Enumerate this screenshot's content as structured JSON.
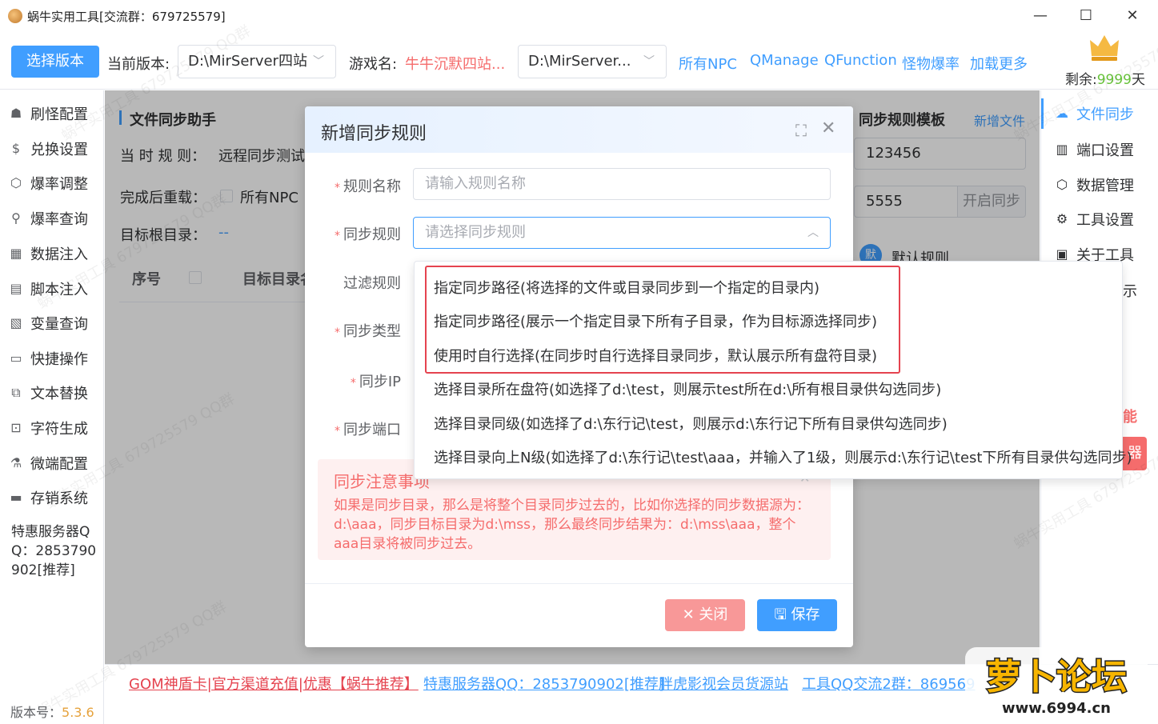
{
  "window": {
    "title": "蜗牛实用工具[交流群：679725579]",
    "minimize": "—",
    "maximize": "☐",
    "close": "✕"
  },
  "toolbar": {
    "select_version_btn": "选择版本",
    "current_version_label": "当前版本:",
    "current_version_value": "D:\\MirServer四站",
    "game_name_label": "游戏名:",
    "game_name_value": "牛牛沉默四站...",
    "path_select_value": "D:\\MirServer...",
    "links": [
      "所有NPC",
      "QManage",
      "QFunction",
      "怪物爆率",
      "加载更多"
    ],
    "remaining_prefix": "剩余:",
    "remaining_value": "9999",
    "remaining_suffix": "天"
  },
  "sidebar": {
    "items": [
      {
        "label": "刷怪配置",
        "icon": "monster-icon"
      },
      {
        "label": "兑换设置",
        "icon": "dollar-icon"
      },
      {
        "label": "爆率调整",
        "icon": "cube-icon"
      },
      {
        "label": "爆率查询",
        "icon": "search-icon"
      },
      {
        "label": "数据注入",
        "icon": "grid-icon"
      },
      {
        "label": "脚本注入",
        "icon": "script-icon"
      },
      {
        "label": "变量查询",
        "icon": "variable-icon"
      },
      {
        "label": "快捷操作",
        "icon": "folder-icon"
      },
      {
        "label": "文本替换",
        "icon": "replace-icon"
      },
      {
        "label": "字符生成",
        "icon": "lock-icon"
      },
      {
        "label": "微端配置",
        "icon": "microscope-icon"
      },
      {
        "label": "存销系统",
        "icon": "shop-icon"
      }
    ],
    "promo": "特惠服务器QQ：2853790902[推荐]",
    "version_label": "版本号：",
    "version_value": "5.3.6"
  },
  "main": {
    "section_title": "文件同步助手",
    "current_rule_label": "当 时 规 则：",
    "current_rule_value": "远程同步测试",
    "reload_label": "完成后重载：",
    "reload_option": "所有NPC",
    "target_dir_label": "目标根目录：",
    "target_dir_value": "--",
    "table_headers": [
      "序号",
      "目标目录名"
    ],
    "template_title": "同步规则模板",
    "add_file_link": "新增文件",
    "template_input_1": "123456",
    "template_input_2": "5555",
    "start_sync_btn": "开启同步",
    "default_rule_badge": "默",
    "default_rule_label": "默认规则"
  },
  "rightbar": {
    "items": [
      {
        "label": "文件同步",
        "icon": "cloud-sync-icon",
        "active": true
      },
      {
        "label": "端口设置",
        "icon": "port-icon",
        "active": false
      },
      {
        "label": "数据管理",
        "icon": "cube-icon",
        "active": false
      },
      {
        "label": "工具设置",
        "icon": "gear-icon",
        "active": false
      },
      {
        "label": "关于工具",
        "icon": "clipboard-icon",
        "active": false
      }
    ],
    "partial_1": "示",
    "partial_2": "能",
    "partial_3": "器"
  },
  "footer": {
    "links": [
      {
        "label": "GOM神盾卡|官方渠道充值|优惠【蜗牛推荐】",
        "color": "#e5434f"
      },
      {
        "label": "特惠服务器QQ：2853790902[推荐]",
        "color": "#409eff"
      },
      {
        "label": "胖虎影视会员货源站",
        "color": "#409eff"
      },
      {
        "label": "工具QQ交流2群：869569",
        "color": "#409eff"
      }
    ]
  },
  "dialog": {
    "title": "新增同步规则",
    "fields": {
      "rule_name_label": "规则名称",
      "rule_name_placeholder": "请输入规则名称",
      "sync_rule_label": "同步规则",
      "sync_rule_placeholder": "请选择同步规则",
      "filter_rule_label": "过滤规则",
      "sync_type_label": "同步类型",
      "sync_ip_label": "同步IP",
      "sync_port_label": "同步端口"
    },
    "alert_title": "同步注意事项",
    "alert_desc": "如果是同步目录，那么是将整个目录同步过去的，比如你选择的同步数据源为：d:\\aaa，同步目标目录为d:\\mss，那么最终同步结果为：d:\\mss\\aaa，整个aaa目录将被同步过去。",
    "close_btn": "关闭",
    "save_btn": "保存"
  },
  "dropdown": {
    "options": [
      "指定同步路径(将选择的文件或目录同步到一个指定的目录内)",
      "指定同步路径(展示一个指定目录下所有子目录，作为目标源选择同步)",
      "使用时自行选择(在同步时自行选择目录同步，默认展示所有盘符目录)",
      "选择目录所在盘符(如选择了d:\\test，则展示test所在d:\\所有根目录供勾选同步)",
      "选择目录同级(如选择了d:\\东行记\\test，则展示d:\\东行记下所有目录供勾选同步)",
      "选择目录向上N级(如选择了d:\\东行记\\test\\aaa，并输入了1级，则展示d:\\东行记\\test下所有目录供勾选同步)"
    ]
  },
  "site_logo": {
    "text": "萝卜论坛",
    "domain": "www.6994.cn"
  },
  "watermark": "蜗牛实用工具 679725579 QQ群",
  "colors": {
    "primary": "#409eff",
    "danger": "#f56c6c",
    "highlight": "#e5434f",
    "remaining": "#67c23a"
  }
}
